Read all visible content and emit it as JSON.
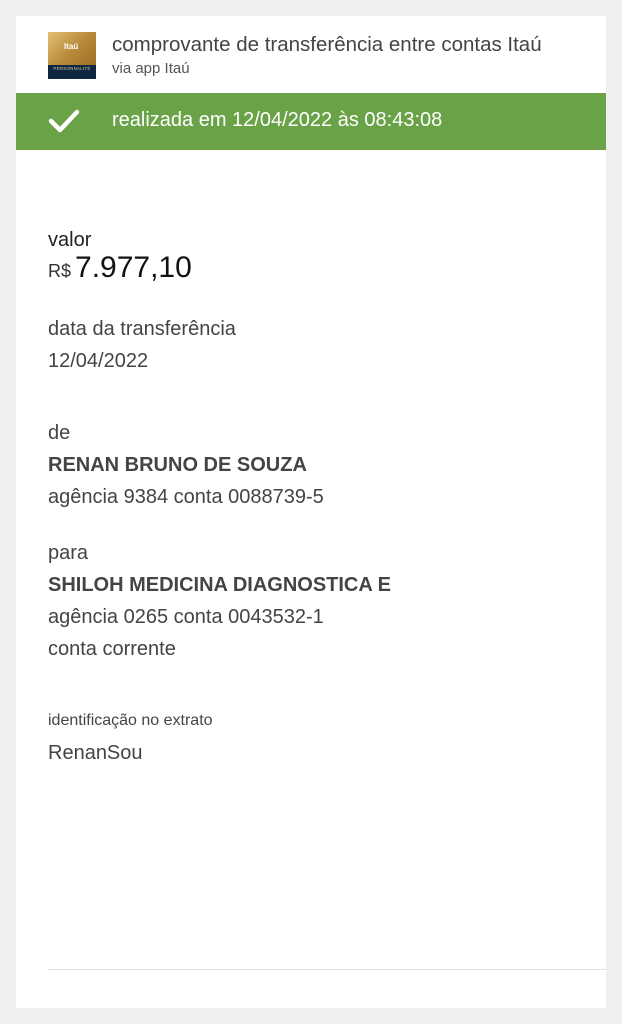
{
  "header": {
    "logo_brand": "Itaú",
    "logo_sub": "PERSONNALITÉ",
    "title": "comprovante de transferência entre contas Itaú",
    "subtitle": "via app Itaú"
  },
  "status": {
    "text": "realizada em 12/04/2022 às 08:43:08",
    "icon": "check-icon",
    "color": "#6aa247"
  },
  "valor": {
    "label": "valor",
    "currency": "R$",
    "amount": "7.977,10"
  },
  "data_transferencia": {
    "label": "data da transferência",
    "value": "12/04/2022"
  },
  "de": {
    "label": "de",
    "name": "RENAN BRUNO DE SOUZA",
    "account": "agência 9384 conta 0088739-5"
  },
  "para": {
    "label": "para",
    "name": "SHILOH MEDICINA DIAGNOSTICA E",
    "account": "agência 0265 conta 0043532-1",
    "account_type": "conta corrente"
  },
  "identificacao": {
    "label": "identificação no extrato",
    "value": "RenanSou"
  }
}
